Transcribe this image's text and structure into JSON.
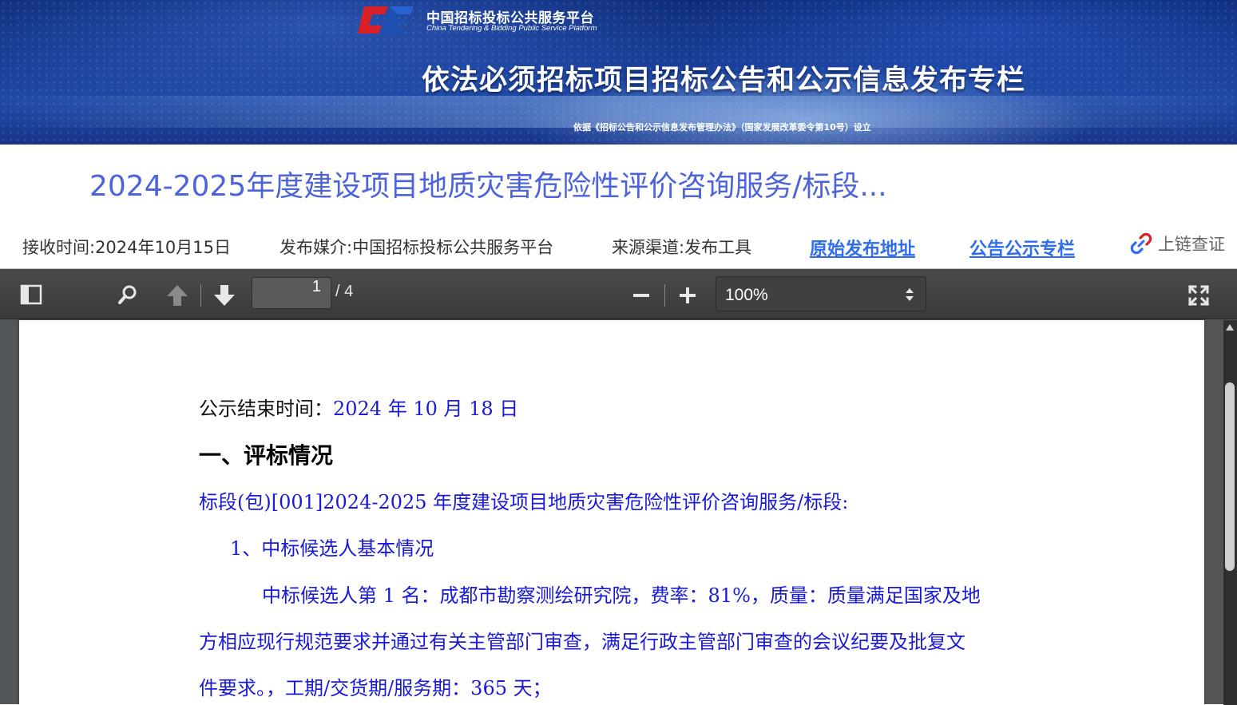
{
  "banner": {
    "logo_cn": "中国招标投标公共服务平台",
    "logo_en": "China Tendering & Bidding Public Service Platform",
    "title": "依法必须招标项目招标公告和公示信息发布专栏",
    "note": "依据《招标公告和公示信息发布管理办法》（国家发展改革委令第10号）设立"
  },
  "page": {
    "title": "2024-2025年度建设项目地质灾害危险性评价咨询服务/标段..."
  },
  "meta": {
    "receive_time": "接收时间:2024年10月15日",
    "media": "发布媒介:中国招标投标公共服务平台",
    "source": "来源渠道:发布工具",
    "original_link": "原始发布地址",
    "column_link": "公告公示专栏",
    "chain_check": "上链查证"
  },
  "viewer": {
    "page_current": "1",
    "page_total": "/ 4",
    "zoom": "100%"
  },
  "pdf": {
    "end_time_label": "公示结束时间：",
    "end_time_value": "2024 年 10 月 18 日",
    "section_heading": "一、评标情况",
    "lot_line": "标段(包)[001]2024-2025 年度建设项目地质灾害危险性评价咨询服务/标段:",
    "sub_heading": "1、中标候选人基本情况",
    "para_line1": "中标候选人第 1 名：成都市勘察测绘研究院，费率：81%，质量：质量满足国家及地",
    "para_line2": "方相应现行规范要求并通过有关主管部门审查，满足行政主管部门审查的会议纪要及批复文",
    "para_line3": "件要求。，工期/交货期/服务期：365 天；"
  },
  "colors": {
    "title_blue": "#4d63d9",
    "link_blue": "#2f6cf0",
    "pdf_blue": "#1a1ad6",
    "logo_red": "#d92027",
    "viewer_bg": "#525659"
  }
}
